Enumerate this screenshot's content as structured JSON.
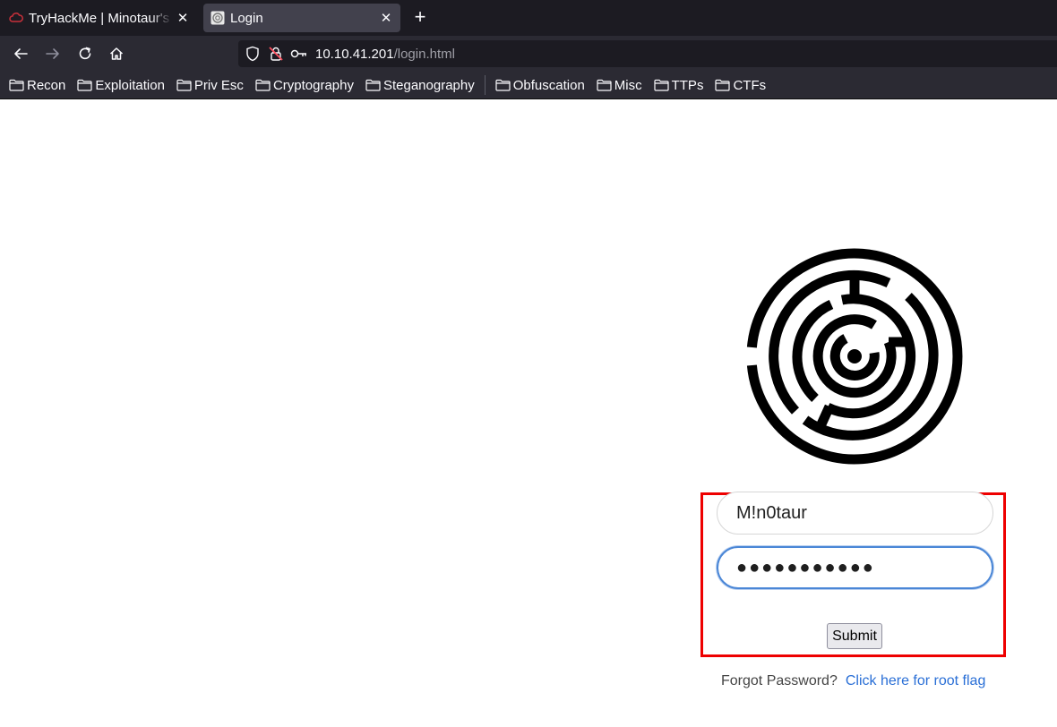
{
  "browser": {
    "tabs": [
      {
        "title": "TryHackMe | Minotaur's Labyrinth",
        "favicon": "thm-cloud-icon",
        "active": false
      },
      {
        "title": "Login",
        "favicon": "globe-icon",
        "active": true
      }
    ],
    "url": {
      "host": "10.10.41.201",
      "path": "/login.html"
    },
    "bookmarks": [
      "Recon",
      "Exploitation",
      "Priv Esc",
      "Cryptography",
      "Steganography",
      "Obfuscation",
      "Misc",
      "TTPs",
      "CTFs"
    ]
  },
  "login": {
    "username_value": "M!n0taur",
    "password_value": "●●●●●●●●●●●",
    "submit_label": "Submit",
    "forgot_text": "Forgot Password?",
    "root_flag_link": "Click here for root flag"
  },
  "colors": {
    "highlight": "#ee0000",
    "link": "#2a6fd6",
    "focus_ring": "#4a86d6"
  }
}
